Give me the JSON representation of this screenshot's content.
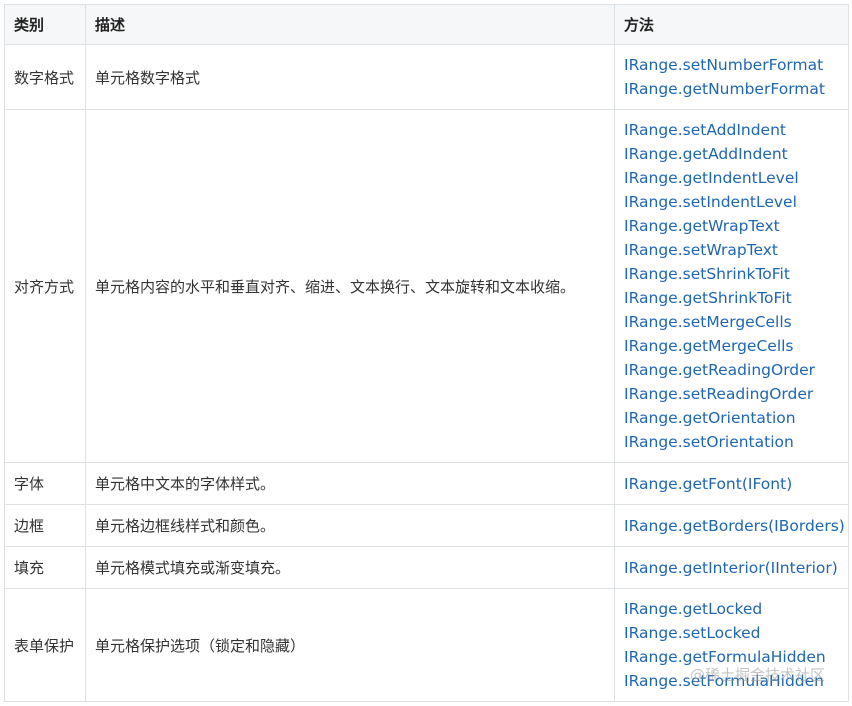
{
  "headers": {
    "category": "类别",
    "description": "描述",
    "methods": "方法"
  },
  "rows": [
    {
      "category": "数字格式",
      "description": "单元格数字格式",
      "methods": [
        "IRange.setNumberFormat",
        "IRange.getNumberFormat"
      ]
    },
    {
      "category": "对齐方式",
      "description": "单元格内容的水平和垂直对齐、缩进、文本换行、文本旋转和文本收缩。",
      "methods": [
        "IRange.setAddIndent",
        "IRange.getAddIndent",
        "IRange.getIndentLevel",
        "IRange.setIndentLevel",
        "IRange.getWrapText",
        "IRange.setWrapText",
        "IRange.setShrinkToFit",
        "IRange.getShrinkToFit",
        "IRange.setMergeCells",
        "IRange.getMergeCells",
        "IRange.getReadingOrder",
        "IRange.setReadingOrder",
        "IRange.getOrientation",
        "IRange.setOrientation"
      ]
    },
    {
      "category": "字体",
      "description": "单元格中文本的字体样式。",
      "methods": [
        "IRange.getFont(IFont)"
      ]
    },
    {
      "category": "边框",
      "description": "单元格边框线样式和颜色。",
      "methods": [
        "IRange.getBorders(IBorders)"
      ]
    },
    {
      "category": "填充",
      "description": "单元格模式填充或渐变填充。",
      "methods": [
        "IRange.getInterior(IInterior)"
      ]
    },
    {
      "category": "表单保护",
      "description": "单元格保护选项（锁定和隐藏）",
      "methods": [
        "IRange.getLocked",
        "IRange.setLocked",
        "IRange.getFormulaHidden",
        "IRange.setFormulaHidden"
      ]
    }
  ],
  "watermark": "@稀土掘金技术社区",
  "colors": {
    "link": "#1f66b3",
    "text": "#333333",
    "header_bg": "#f6f7f8",
    "border": "#dfe2e5"
  }
}
